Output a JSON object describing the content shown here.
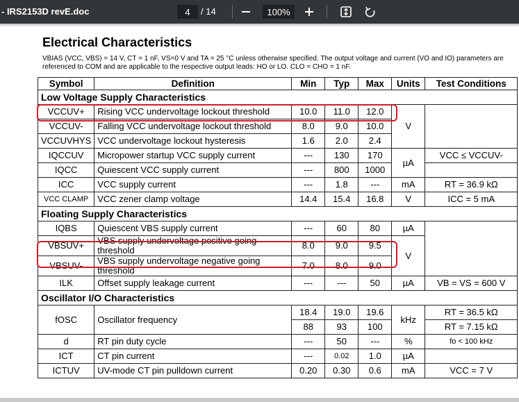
{
  "toolbar": {
    "doc_title": "- IRS2153D revE.doc",
    "page_current": "4",
    "page_total": "/ 14",
    "zoom_minus": "—",
    "zoom_value": "100%",
    "zoom_plus": "+",
    "icons": [
      "fit-page-icon",
      "rotate-icon"
    ]
  },
  "page": {
    "heading": "Electrical Characteristics",
    "note_line1": "VBIAS (VCC, VBS) = 14 V, CT = 1 nF, VS=0 V and TA = 25 °C unless otherwise specified. The output voltage and current (VO and IO) parameters are",
    "note_line2": "referenced to COM and are applicable to the respective output leads: HO or LO. CLO = CHO = 1 nF."
  },
  "table": {
    "headers": [
      "Symbol",
      "Definition",
      "Min",
      "Typ",
      "Max",
      "Units",
      "Test Conditions"
    ],
    "sections": {
      "low": "Low Voltage Supply Characteristics",
      "floating": "Floating Supply Characteristics",
      "osc": "Oscillator I/O Characteristics"
    },
    "rows": {
      "vccuvp": {
        "sym": "VCCUV+",
        "def": "Rising VCC undervoltage lockout threshold",
        "min": "10.0",
        "typ": "11.0",
        "max": "12.0"
      },
      "vccuvm": {
        "sym": "VCCUV-",
        "def": "Falling VCC undervoltage lockout threshold",
        "min": "8.0",
        "typ": "9.0",
        "max": "10.0",
        "units": "V"
      },
      "vccuvhys": {
        "sym": "VCCUVHYS",
        "def": "VCC undervoltage lockout hysteresis",
        "min": "1.6",
        "typ": "2.0",
        "max": "2.4"
      },
      "iqccuv": {
        "sym": "IQCCUV",
        "def": "Micropower startup VCC supply current",
        "min": "---",
        "typ": "130",
        "max": "170",
        "cond": "VCC ≤ VCCUV-"
      },
      "iqcc": {
        "sym": "IQCC",
        "def": "Quiescent VCC supply current",
        "min": "---",
        "typ": "800",
        "max": "1000",
        "units": "µA"
      },
      "icc": {
        "sym": "ICC",
        "def": "VCC supply current",
        "min": "---",
        "typ": "1.8",
        "max": "---",
        "units": "mA",
        "cond": "RT = 36.9 kΩ"
      },
      "vccclamp": {
        "sym": "VCC CLAMP",
        "def": "VCC zener clamp voltage",
        "min": "14.4",
        "typ": "15.4",
        "max": "16.8",
        "units": "V",
        "cond": "ICC = 5 mA"
      },
      "iqbs": {
        "sym": "IQBS",
        "def": "Quiescent VBS supply current",
        "min": "---",
        "typ": "60",
        "max": "80",
        "units": "µA"
      },
      "vbsuvp": {
        "sym": "VBSUV+",
        "def1": "VBS supply undervoltage positive going",
        "def2": "threshold",
        "min": "8.0",
        "typ": "9.0",
        "max": "9.5"
      },
      "vbsuvm": {
        "sym": "VBSUV-",
        "def1": "VBS supply undervoltage negative going",
        "def2": "threshold",
        "min": "7.0",
        "typ": "8.0",
        "max": "9.0",
        "units": "V"
      },
      "ilk": {
        "sym": "ILK",
        "def": "Offset supply leakage current",
        "min": "---",
        "typ": "---",
        "max": "50",
        "units": "µA",
        "cond": "VB = VS = 600 V"
      },
      "fosc1": {
        "sym": "fOSC",
        "def": "Oscillator frequency",
        "min": "18.4",
        "typ": "19.0",
        "max": "19.6",
        "units": "kHz",
        "cond": "RT = 36.5 kΩ"
      },
      "fosc2": {
        "min": "88",
        "typ": "93",
        "max": "100",
        "cond": "RT = 7.15 kΩ"
      },
      "d": {
        "sym": "d",
        "def": "RT pin duty cycle",
        "min": "---",
        "typ": "50",
        "max": "---",
        "units": "%",
        "cond": "fo < 100 kHz"
      },
      "ict": {
        "sym": "ICT",
        "def": "CT pin current",
        "min": "---",
        "typ": "0.02",
        "max": "1.0",
        "units": "µA"
      },
      "ictuv": {
        "sym": "ICTUV",
        "def": "UV-mode CT pin pulldown current",
        "min": "0.20",
        "typ": "0.30",
        "max": "0.6",
        "units": "mA",
        "cond": "VCC = 7 V"
      }
    }
  },
  "colors": {
    "toolbar": "#323639",
    "highlight": "#d11a2a"
  }
}
